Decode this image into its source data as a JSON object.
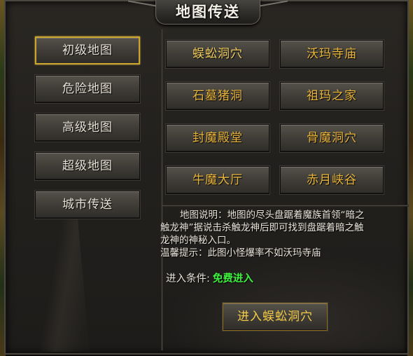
{
  "window": {
    "title": "地图传送"
  },
  "categories": [
    {
      "label": "初级地图",
      "active": true
    },
    {
      "label": "危险地图",
      "active": false
    },
    {
      "label": "高级地图",
      "active": false
    },
    {
      "label": "超级地图",
      "active": false
    },
    {
      "label": "城市传送",
      "active": false
    }
  ],
  "maps": [
    {
      "label": "蜈蚣洞穴",
      "active": true
    },
    {
      "label": "沃玛寺庙",
      "active": false
    },
    {
      "label": "石墓猪洞",
      "active": false
    },
    {
      "label": "祖玛之家",
      "active": false
    },
    {
      "label": "封魔殿堂",
      "active": false
    },
    {
      "label": "骨魔洞穴",
      "active": false
    },
    {
      "label": "牛魔大厅",
      "active": false
    },
    {
      "label": "赤月峡谷",
      "active": false
    }
  ],
  "description": {
    "line1": "地图说明：地图的尽头盘踞着魔族首领“暗之",
    "line2": "触龙神”据说击杀触龙神后即可找到盘踞着暗之触",
    "line3": "龙神的神秘入口。",
    "line4": "温馨提示：此图小怪爆率不如沃玛寺庙"
  },
  "condition": {
    "label": "进入条件:",
    "value": "免费进入"
  },
  "enter_button": {
    "label": "进入蜈蚣洞穴"
  },
  "colors": {
    "accent_gold": "#e8b43a",
    "active_border": "#c9a430",
    "free_green": "#3ef03e"
  }
}
